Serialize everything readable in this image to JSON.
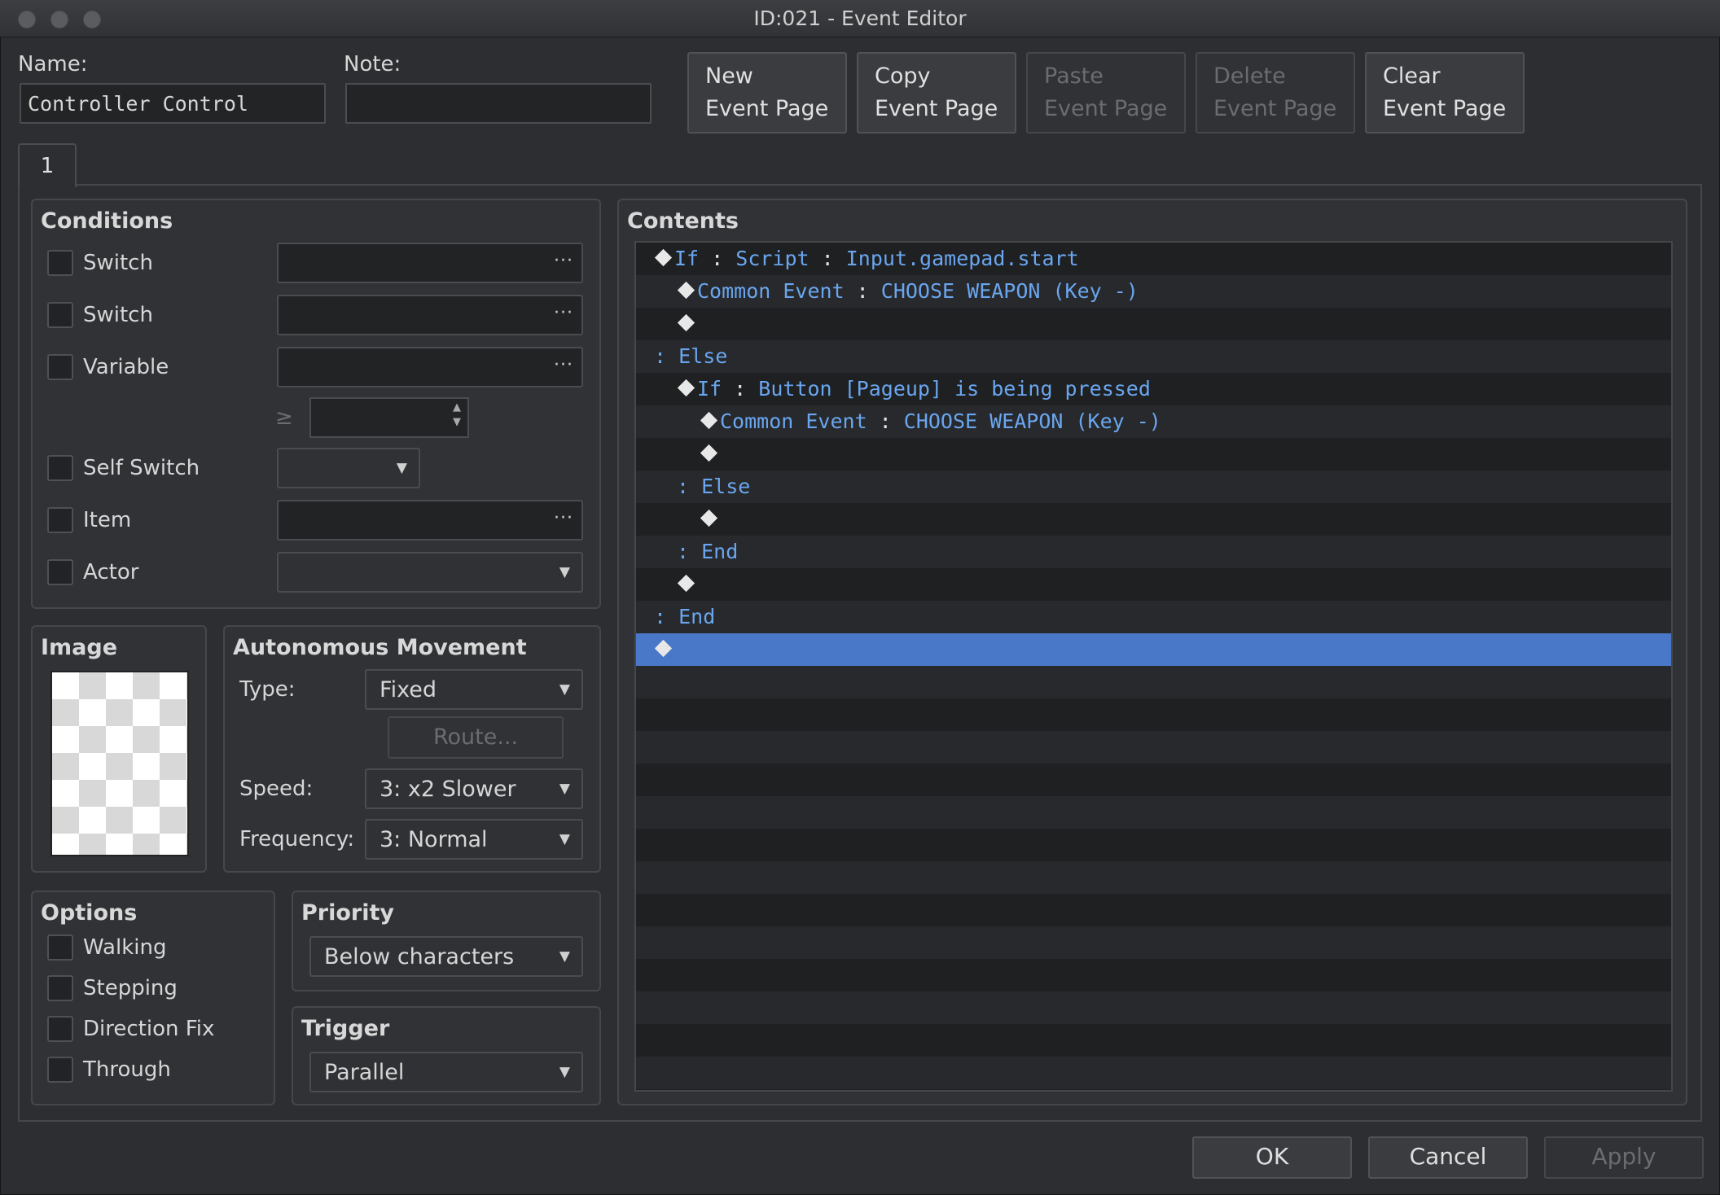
{
  "window": {
    "title": "ID:021 - Event Editor"
  },
  "header": {
    "name_label": "Name:",
    "name_value": "Controller Control",
    "note_label": "Note:",
    "note_value": "",
    "buttons": [
      {
        "line1": "New",
        "line2": "Event Page",
        "enabled": true
      },
      {
        "line1": "Copy",
        "line2": "Event Page",
        "enabled": true
      },
      {
        "line1": "Paste",
        "line2": "Event Page",
        "enabled": false
      },
      {
        "line1": "Delete",
        "line2": "Event Page",
        "enabled": false
      },
      {
        "line1": "Clear",
        "line2": "Event Page",
        "enabled": true
      }
    ]
  },
  "tabs": [
    {
      "label": "1"
    }
  ],
  "conditions": {
    "title": "Conditions",
    "switch1_label": "Switch",
    "switch2_label": "Switch",
    "variable_label": "Variable",
    "gte_symbol": "≥",
    "self_switch_label": "Self Switch",
    "item_label": "Item",
    "actor_label": "Actor",
    "more_glyph": "···",
    "dropdown_glyph": "▼"
  },
  "image": {
    "title": "Image"
  },
  "autonomous": {
    "title": "Autonomous Movement",
    "type_label": "Type:",
    "type_value": "Fixed",
    "route_label": "Route...",
    "speed_label": "Speed:",
    "speed_value": "3: x2 Slower",
    "frequency_label": "Frequency:",
    "frequency_value": "3: Normal"
  },
  "options": {
    "title": "Options",
    "walking": "Walking",
    "stepping": "Stepping",
    "direction_fix": "Direction Fix",
    "through": "Through"
  },
  "priority": {
    "title": "Priority",
    "value": "Below characters"
  },
  "trigger": {
    "title": "Trigger",
    "value": "Parallel"
  },
  "contents": {
    "title": "Contents",
    "rows": [
      {
        "indent": 0,
        "kind": "diamond",
        "text": "If",
        "tail": "Script",
        "rest": "Input.gamepad.start"
      },
      {
        "indent": 1,
        "kind": "diamond",
        "text": "Common Event",
        "tail": "CHOOSE WEAPON (Key -)",
        "rest": ""
      },
      {
        "indent": 1,
        "kind": "diamond",
        "text": "",
        "tail": "",
        "rest": ""
      },
      {
        "indent": 0,
        "kind": "colon",
        "text": "Else",
        "tail": "",
        "rest": ""
      },
      {
        "indent": 1,
        "kind": "diamond",
        "text": "If",
        "tail": "Button [Pageup] is being pressed",
        "rest": ""
      },
      {
        "indent": 2,
        "kind": "diamond",
        "text": "Common Event",
        "tail": "CHOOSE WEAPON (Key -)",
        "rest": ""
      },
      {
        "indent": 2,
        "kind": "diamond",
        "text": "",
        "tail": "",
        "rest": ""
      },
      {
        "indent": 1,
        "kind": "colon",
        "text": "Else",
        "tail": "",
        "rest": ""
      },
      {
        "indent": 2,
        "kind": "diamond",
        "text": "",
        "tail": "",
        "rest": ""
      },
      {
        "indent": 1,
        "kind": "colon",
        "text": "End",
        "tail": "",
        "rest": ""
      },
      {
        "indent": 1,
        "kind": "diamond",
        "text": "",
        "tail": "",
        "rest": ""
      },
      {
        "indent": 0,
        "kind": "colon",
        "text": "End",
        "tail": "",
        "rest": ""
      },
      {
        "indent": 0,
        "kind": "diamond",
        "text": "",
        "tail": "",
        "rest": "",
        "selected": true
      }
    ]
  },
  "footer": {
    "ok": "OK",
    "cancel": "Cancel",
    "apply": "Apply"
  },
  "colors": {
    "command_text": "#6aa6ef",
    "selection": "#4a78c8"
  }
}
